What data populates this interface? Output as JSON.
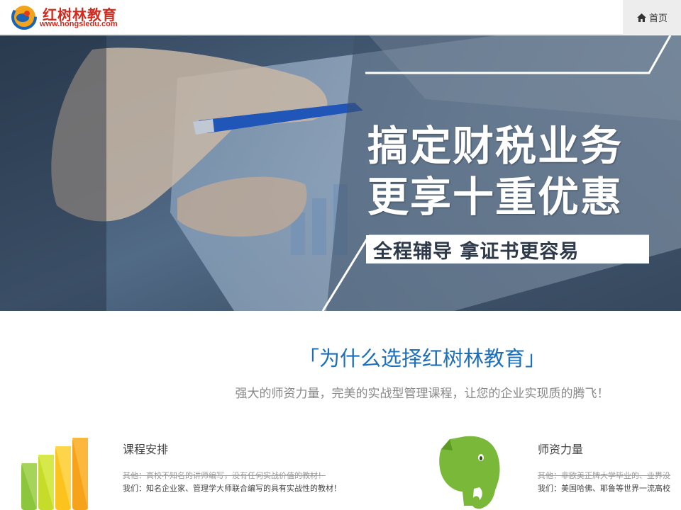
{
  "header": {
    "logo_name": "红树林教育",
    "logo_url": "www.hongsledu.com",
    "home_label": "首页"
  },
  "banner": {
    "headline_1": "搞定财税业务",
    "headline_2": "更享十重优惠",
    "subline": "全程辅导 拿证书更容易",
    "slides_total": 3,
    "slide_active": 1
  },
  "section": {
    "title": "「为什么选择红树林教育」",
    "subtitle": "强大的师资力量，完美的实战型管理课程，让您的企业实现质的腾飞！"
  },
  "features": [
    {
      "title": "课程安排",
      "other": "其他：高校不知名的讲师编写，没有任何实战价值的教材！",
      "ours": "我们：知名企业家、管理学大师联合编写的具有实战性的教材！"
    },
    {
      "title": "师资力量",
      "other": "其他：非欧美正牌大学毕业的、业界没",
      "ours": "我们：美国哈佛、耶鲁等世界一流高校"
    }
  ],
  "colors": {
    "brand_red": "#d42a1e",
    "accent_blue": "#1d6fb8",
    "banner_overlay": "#3d5068"
  }
}
